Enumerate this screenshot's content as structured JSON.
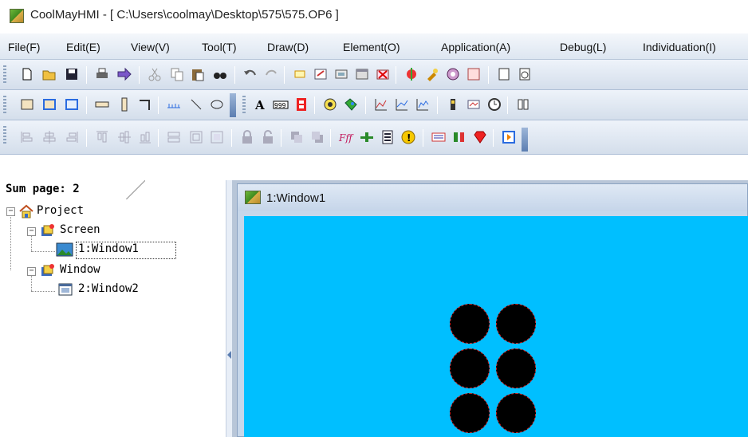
{
  "window": {
    "title": "CoolMayHMI - [ C:\\Users\\coolmay\\Desktop\\575\\575.OP6 ]",
    "icon": "app-icon"
  },
  "menu": [
    {
      "label": "File(F)"
    },
    {
      "label": "Edit(E)"
    },
    {
      "label": "View(V)"
    },
    {
      "label": "Tool(T)"
    },
    {
      "label": "Draw(D)"
    },
    {
      "label": "Element(O)"
    },
    {
      "label": "Application(A)"
    },
    {
      "label": "Debug(L)"
    },
    {
      "label": "Individuation(I)"
    }
  ],
  "toolbars": {
    "standard": [
      "new-icon",
      "open-icon",
      "save-icon",
      "print-icon",
      "download-icon",
      "cut-icon",
      "copy-icon",
      "paste-icon",
      "find-icon",
      "undo-icon",
      "redo-icon",
      "select-icon",
      "properties-icon",
      "screen-icon",
      "window-icon",
      "delete-icon",
      "compile-icon",
      "tools-icon",
      "simulate-icon",
      "function-icon",
      "page-icon",
      "clock-icon"
    ],
    "draw": [
      "rectangle-icon",
      "rect-blue-icon",
      "rect-fill-icon",
      "hbar-icon",
      "vbar-icon",
      "corner-line-icon",
      "scale-icon",
      "line-icon",
      "ellipse-icon",
      "text-icon",
      "number-icon",
      "digit-icon",
      "lamp-icon",
      "bitmap-icon",
      "trend-icon",
      "xy-chart-icon",
      "bar-chart-icon",
      "meter-icon",
      "message-icon",
      "clock-element-icon",
      "recipe-icon"
    ],
    "edit": [
      "align-left-icon",
      "align-center-icon",
      "align-right-icon",
      "align-top-icon",
      "align-middle-icon",
      "align-bottom-icon",
      "same-width-icon",
      "same-height-icon",
      "same-size-icon",
      "lock-icon",
      "unlock-icon",
      "front-icon",
      "back-icon",
      "function-key-icon",
      "bit-switch-icon",
      "list-icon",
      "alarm-icon",
      "keyboard-icon",
      "signal-icon",
      "gem-icon",
      "play-icon"
    ]
  },
  "project_tree": {
    "sum_page": "Sum page: 2",
    "root": "Project",
    "screen_group": "Screen",
    "screen_item": "1:Window1",
    "window_group": "Window",
    "window_item": "2:Window2"
  },
  "child_window": {
    "title": "1:Window1"
  },
  "canvas": {
    "background": "#00bfff",
    "lamp_color": "#000000",
    "lamp_border": "#d01a1a",
    "lamp_count": 6
  }
}
